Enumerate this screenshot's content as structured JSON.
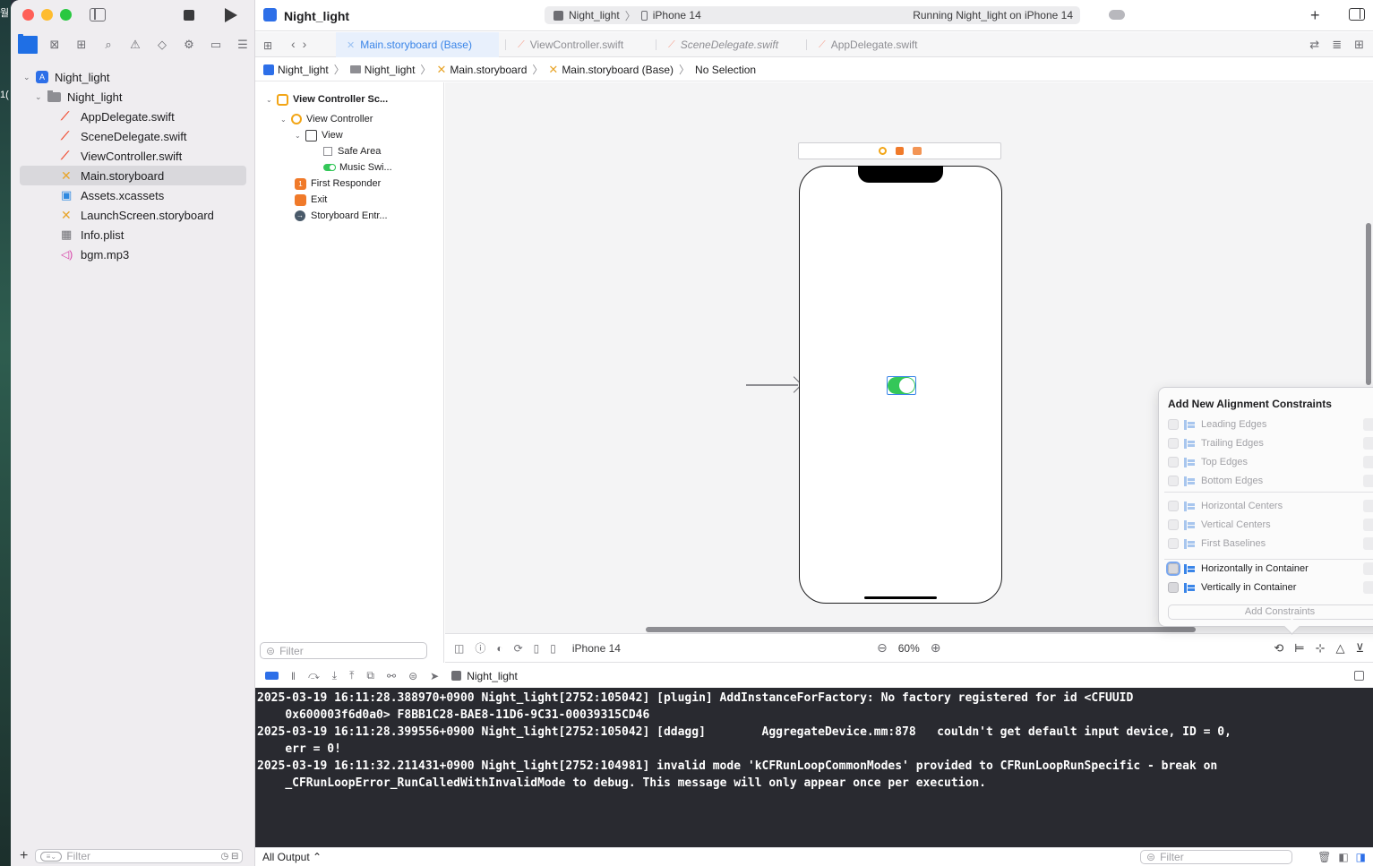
{
  "desktop": {
    "edge_text_top": "월",
    "edge_text_mid": "1("
  },
  "sidebar": {
    "nav_icons": [
      "folder-icon",
      "source-control-icon",
      "hierarchy-icon",
      "search-icon",
      "warning-icon",
      "test-icon",
      "debug-icon",
      "breakpoint-icon",
      "report-icon"
    ],
    "tree": [
      {
        "label": "Night_light",
        "level": 0,
        "kind": "project",
        "expanded": true
      },
      {
        "label": "Night_light",
        "level": 1,
        "kind": "group",
        "expanded": true
      },
      {
        "label": "AppDelegate.swift",
        "level": 2,
        "kind": "swift"
      },
      {
        "label": "SceneDelegate.swift",
        "level": 2,
        "kind": "swift"
      },
      {
        "label": "ViewController.swift",
        "level": 2,
        "kind": "swift"
      },
      {
        "label": "Main.storyboard",
        "level": 2,
        "kind": "storyboard",
        "selected": true
      },
      {
        "label": "Assets.xcassets",
        "level": 2,
        "kind": "assets"
      },
      {
        "label": "LaunchScreen.storyboard",
        "level": 2,
        "kind": "storyboard"
      },
      {
        "label": "Info.plist",
        "level": 2,
        "kind": "plist"
      },
      {
        "label": "bgm.mp3",
        "level": 2,
        "kind": "audio"
      }
    ],
    "filter_placeholder": "Filter"
  },
  "toolbar": {
    "title": "Night_light",
    "scheme_target": "Night_light",
    "scheme_device": "iPhone 14",
    "status": "Running Night_light on iPhone 14"
  },
  "tabs": [
    {
      "label": "Main.storyboard (Base)",
      "active": true
    },
    {
      "label": "ViewController.swift",
      "active": false
    },
    {
      "label": "SceneDelegate.swift",
      "active": false
    },
    {
      "label": "AppDelegate.swift",
      "active": false
    }
  ],
  "breadcrumb": {
    "items": [
      "Night_light",
      "Night_light",
      "Main.storyboard",
      "Main.storyboard (Base)",
      "No Selection"
    ]
  },
  "outline": {
    "rows": [
      {
        "label": "View Controller Sc...",
        "icon": "scene",
        "bold": true
      },
      {
        "label": "View Controller",
        "icon": "vc"
      },
      {
        "label": "View",
        "icon": "view"
      },
      {
        "label": "Safe Area",
        "icon": "safe"
      },
      {
        "label": "Music Swi...",
        "icon": "switch"
      },
      {
        "label": "First Responder",
        "icon": "first"
      },
      {
        "label": "Exit",
        "icon": "exit"
      },
      {
        "label": "Storyboard Entr...",
        "icon": "entry"
      }
    ],
    "filter_placeholder": "Filter"
  },
  "canvas_bar": {
    "device": "iPhone 14",
    "zoom": "60%"
  },
  "popover": {
    "title": "Add New Alignment Constraints",
    "rows": [
      {
        "label": "Leading Edges",
        "enabled": false
      },
      {
        "label": "Trailing Edges",
        "enabled": false
      },
      {
        "label": "Top Edges",
        "enabled": false
      },
      {
        "label": "Bottom Edges",
        "enabled": false
      },
      {
        "label": "Horizontal Centers",
        "enabled": false
      },
      {
        "label": "Vertical Centers",
        "enabled": false
      },
      {
        "label": "First Baselines",
        "enabled": false
      },
      {
        "label": "Horizontally in Container",
        "enabled": true
      },
      {
        "label": "Vertically in Container",
        "enabled": true
      }
    ],
    "add_button": "Add Constraints"
  },
  "debug": {
    "target": "Night_light"
  },
  "console": {
    "lines": [
      "2025-03-19 16:11:28.388970+0900 Night_light[2752:105042] [plugin] AddInstanceForFactory: No factory registered for id <CFUUID\n    0x600003f6d0a0> F8BB1C28-BAE8-11D6-9C31-00039315CD46",
      "2025-03-19 16:11:28.399556+0900 Night_light[2752:105042] [ddagg]        AggregateDevice.mm:878   couldn't get default input device, ID = 0,\n    err = 0!",
      "2025-03-19 16:11:32.211431+0900 Night_light[2752:104981] invalid mode 'kCFRunLoopCommonModes' provided to CFRunLoopRunSpecific - break on\n    _CFRunLoopError_RunCalledWithInvalidMode to debug. This message will only appear once per execution."
    ],
    "output_selector": "All Output ⌃",
    "filter_placeholder": "Filter"
  }
}
